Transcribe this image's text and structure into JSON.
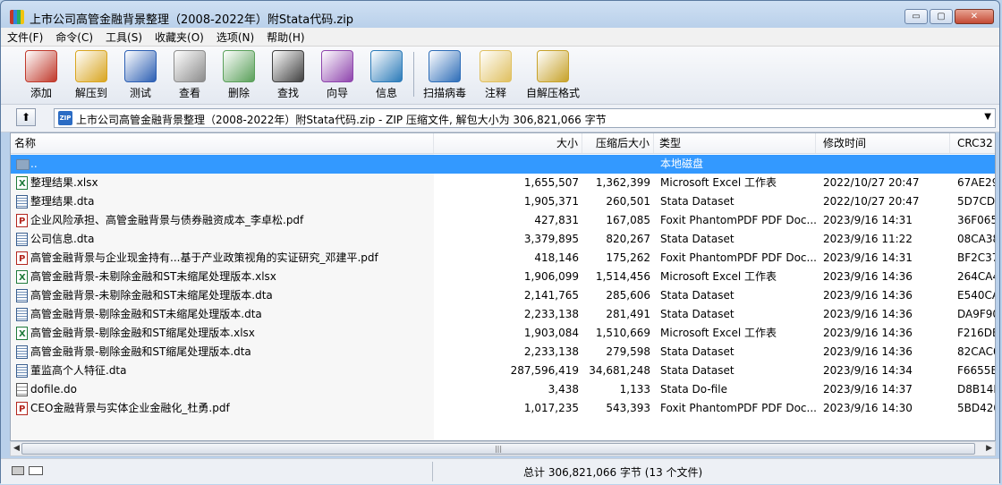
{
  "window": {
    "title": "上市公司高管金融背景整理（2008-2022年）附Stata代码.zip",
    "minimize": "▭",
    "maximize": "▢",
    "close": "✕"
  },
  "menu": [
    "文件(F)",
    "命令(C)",
    "工具(S)",
    "收藏夹(O)",
    "选项(N)",
    "帮助(H)"
  ],
  "toolbar": [
    {
      "label": "添加",
      "icon": "add-books-icon",
      "color": "#c0392b"
    },
    {
      "label": "解压到",
      "icon": "extract-folder-icon",
      "color": "#d9a520"
    },
    {
      "label": "测试",
      "icon": "test-check-icon",
      "color": "#2c5fb3"
    },
    {
      "label": "查看",
      "icon": "view-glasses-icon",
      "color": "#8c8c8c"
    },
    {
      "label": "删除",
      "icon": "delete-icon",
      "color": "#5aa05a"
    },
    {
      "label": "查找",
      "icon": "find-binoculars-icon",
      "color": "#404040"
    },
    {
      "label": "向导",
      "icon": "wizard-icon",
      "color": "#8e44ad"
    },
    {
      "label": "信息",
      "icon": "info-icon",
      "color": "#2b7bb9"
    },
    {
      "label": "扫描病毒",
      "icon": "virus-scan-icon",
      "color": "#2d6db8"
    },
    {
      "label": "注释",
      "icon": "comment-icon",
      "color": "#e0c060"
    },
    {
      "label": "自解压格式",
      "icon": "sfx-icon",
      "color": "#c7a22a"
    }
  ],
  "address": {
    "text": "上市公司高管金融背景整理（2008-2022年）附Stata代码.zip - ZIP 压缩文件, 解包大小为 306,821,066 字节",
    "up_glyph": "⬆",
    "zip_badge": "ZIP",
    "dropdown_glyph": "▼"
  },
  "columns": {
    "name": "名称",
    "size": "大小",
    "packed": "压缩后大小",
    "type": "类型",
    "modified": "修改时间",
    "crc": "CRC32"
  },
  "rows": [
    {
      "name": "..",
      "size": "",
      "packed": "",
      "type": "本地磁盘",
      "modified": "",
      "crc": "",
      "icon": "folder",
      "selected": true
    },
    {
      "name": "整理结果.xlsx",
      "size": "1,655,507",
      "packed": "1,362,399",
      "type": "Microsoft Excel 工作表",
      "modified": "2022/10/27 20:47",
      "crc": "67AE29",
      "icon": "xlsx"
    },
    {
      "name": "整理结果.dta",
      "size": "1,905,371",
      "packed": "260,501",
      "type": "Stata Dataset",
      "modified": "2022/10/27 20:47",
      "crc": "5D7CDI",
      "icon": "dta"
    },
    {
      "name": "企业风险承担、高管金融背景与债券融资成本_李卓松.pdf",
      "size": "427,831",
      "packed": "167,085",
      "type": "Foxit PhantomPDF PDF Doc...",
      "modified": "2023/9/16 14:31",
      "crc": "36F065",
      "icon": "pdf"
    },
    {
      "name": "公司信息.dta",
      "size": "3,379,895",
      "packed": "820,267",
      "type": "Stata Dataset",
      "modified": "2023/9/16 11:22",
      "crc": "08CA38",
      "icon": "dta"
    },
    {
      "name": "高管金融背景与企业现金持有...基于产业政策视角的实证研究_邓建平.pdf",
      "size": "418,146",
      "packed": "175,262",
      "type": "Foxit PhantomPDF PDF Doc...",
      "modified": "2023/9/16 14:31",
      "crc": "BF2C37",
      "icon": "pdf"
    },
    {
      "name": "高管金融背景-未剔除金融和ST未缩尾处理版本.xlsx",
      "size": "1,906,099",
      "packed": "1,514,456",
      "type": "Microsoft Excel 工作表",
      "modified": "2023/9/16 14:36",
      "crc": "264CA4",
      "icon": "xlsx"
    },
    {
      "name": "高管金融背景-未剔除金融和ST未缩尾处理版本.dta",
      "size": "2,141,765",
      "packed": "285,606",
      "type": "Stata Dataset",
      "modified": "2023/9/16 14:36",
      "crc": "E540CA",
      "icon": "dta"
    },
    {
      "name": "高管金融背景-剔除金融和ST未缩尾处理版本.dta",
      "size": "2,233,138",
      "packed": "281,491",
      "type": "Stata Dataset",
      "modified": "2023/9/16 14:36",
      "crc": "DA9F90",
      "icon": "dta"
    },
    {
      "name": "高管金融背景-剔除金融和ST缩尾处理版本.xlsx",
      "size": "1,903,084",
      "packed": "1,510,669",
      "type": "Microsoft Excel 工作表",
      "modified": "2023/9/16 14:36",
      "crc": "F216DE",
      "icon": "xlsx"
    },
    {
      "name": "高管金融背景-剔除金融和ST缩尾处理版本.dta",
      "size": "2,233,138",
      "packed": "279,598",
      "type": "Stata Dataset",
      "modified": "2023/9/16 14:36",
      "crc": "82CAC0",
      "icon": "dta"
    },
    {
      "name": "董监高个人特征.dta",
      "size": "287,596,419",
      "packed": "34,681,248",
      "type": "Stata Dataset",
      "modified": "2023/9/16 14:34",
      "crc": "F6655E",
      "icon": "dta"
    },
    {
      "name": "dofile.do",
      "size": "3,438",
      "packed": "1,133",
      "type": "Stata Do-file",
      "modified": "2023/9/16 14:37",
      "crc": "D8B14F",
      "icon": "do"
    },
    {
      "name": "CEO金融背景与实体企业金融化_杜勇.pdf",
      "size": "1,017,235",
      "packed": "543,393",
      "type": "Foxit PhantomPDF PDF Doc...",
      "modified": "2023/9/16 14:30",
      "crc": "5BD420",
      "icon": "pdf"
    }
  ],
  "scrollbar": {
    "left": "◀",
    "right": "▶",
    "grip": "|||"
  },
  "status": {
    "summary": "总计 306,821,066 字节 (13 个文件)"
  }
}
